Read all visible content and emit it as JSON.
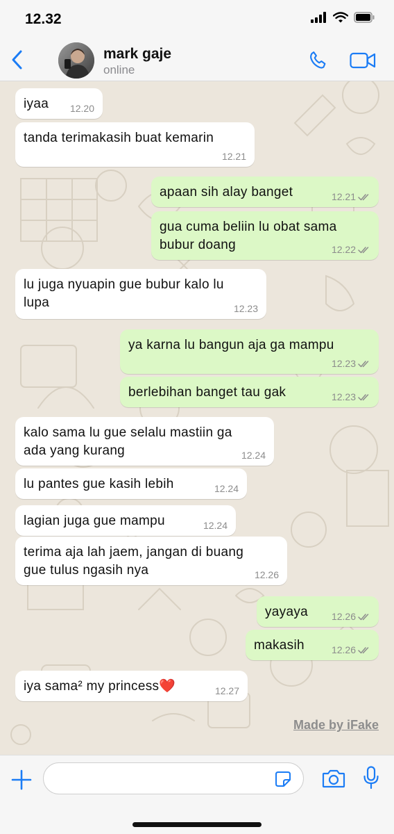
{
  "status_bar": {
    "time": "12.32"
  },
  "header": {
    "contact_name": "mark gaje",
    "contact_status": "online"
  },
  "messages": [
    {
      "direction": "in",
      "text": "iyaa",
      "time": "12.20"
    },
    {
      "direction": "in",
      "text": "tanda terimakasih buat kemarin",
      "time": "12.21"
    },
    {
      "direction": "out",
      "text": "apaan sih alay banget",
      "time": "12.21",
      "read": true
    },
    {
      "direction": "out",
      "text": "gua cuma beliin lu obat sama\nbubur doang",
      "time": "12.22",
      "read": true
    },
    {
      "direction": "in",
      "text": "lu juga nyuapin gue bubur kalo lu\nlupa",
      "time": "12.23"
    },
    {
      "direction": "out",
      "text": "ya karna lu bangun aja ga mampu",
      "time": "12.23",
      "read": true
    },
    {
      "direction": "out",
      "text": "berlebihan banget tau gak",
      "time": "12.23",
      "read": true
    },
    {
      "direction": "in",
      "text": "kalo sama lu gue selalu mastiin ga\nada yang kurang",
      "time": "12.24"
    },
    {
      "direction": "in",
      "text": "lu pantes gue kasih lebih",
      "time": "12.24"
    },
    {
      "direction": "in",
      "text": "lagian juga gue mampu",
      "time": "12.24"
    },
    {
      "direction": "in",
      "text": "terima aja lah jaem, jangan di buang\ngue tulus ngasih nya",
      "time": "12.26"
    },
    {
      "direction": "out",
      "text": "yayaya",
      "time": "12.26",
      "read": true
    },
    {
      "direction": "out",
      "text": "makasih",
      "time": "12.26",
      "read": true
    },
    {
      "direction": "in",
      "text": "iya sama² my princess❤️",
      "time": "12.27"
    }
  ],
  "watermark": "Made by iFake",
  "input": {
    "value": "",
    "placeholder": ""
  },
  "icons": {
    "back": "chevron-left-icon",
    "call": "phone-icon",
    "video": "video-camera-icon",
    "attach": "plus-icon",
    "sticker": "sticker-icon",
    "camera": "camera-icon",
    "mic": "microphone-icon",
    "read": "double-check-icon"
  },
  "colors": {
    "accent": "#1b7cf5",
    "incoming_bubble": "#ffffff",
    "outgoing_bubble": "#dcf8c6",
    "wallpaper": "#ece6dc"
  }
}
